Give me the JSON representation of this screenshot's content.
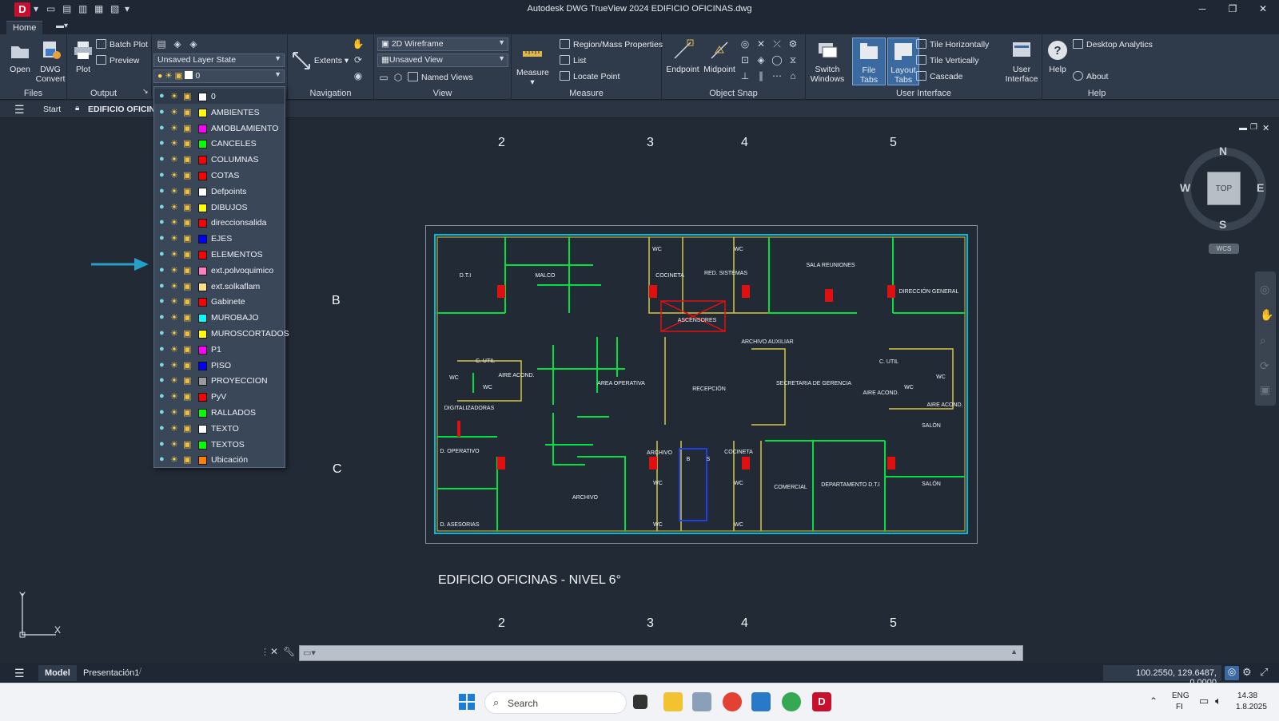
{
  "window": {
    "title": "Autodesk DWG TrueView 2024   EDIFICIO OFICINAS.dwg",
    "app_letter": "D"
  },
  "ribbon_tabs": [
    "Home"
  ],
  "ribbon": {
    "files": {
      "title": "Files",
      "open": "Open",
      "dwg_convert_1": "DWG",
      "dwg_convert_2": "Convert"
    },
    "output": {
      "title": "Output",
      "plot": "Plot",
      "batch_plot": "Batch Plot",
      "preview": "Preview"
    },
    "layers": {
      "layer_state": "Unsaved Layer State",
      "current_layer": "0"
    },
    "navigation": {
      "title": "Navigation",
      "extents": "Extents"
    },
    "view": {
      "title": "View",
      "visual_style": "2D Wireframe",
      "saved_view": "Unsaved View",
      "named_views": "Named Views"
    },
    "measure": {
      "title": "Measure",
      "measure": "Measure",
      "region_mass": "Region/Mass Properties",
      "list": "List",
      "locate_point": "Locate Point"
    },
    "osnap": {
      "title": "Object Snap",
      "endpoint": "Endpoint",
      "midpoint": "Midpoint"
    },
    "ui": {
      "title": "User Interface",
      "switch_1": "Switch",
      "switch_2": "Windows",
      "file_tabs": "File Tabs",
      "layout_1": "Layout",
      "layout_2": "Tabs",
      "tile_h": "Tile Horizontally",
      "tile_v": "Tile Vertically",
      "cascade": "Cascade",
      "user_1": "User",
      "user_2": "Interface"
    },
    "help": {
      "title": "Help",
      "help": "Help",
      "desktop_analytics": "Desktop Analytics",
      "about": "About"
    }
  },
  "file_tabs": {
    "start": "Start",
    "current": "EDIFICIO OFICINA"
  },
  "layers": [
    {
      "name": "0",
      "color": "#ffffff"
    },
    {
      "name": "AMBIENTES",
      "color": "#ffff00"
    },
    {
      "name": "AMOBLAMIENTO",
      "color": "#ff00ff"
    },
    {
      "name": "CANCELES",
      "color": "#00ff00"
    },
    {
      "name": "COLUMNAS",
      "color": "#ff0000"
    },
    {
      "name": "COTAS",
      "color": "#ff0000"
    },
    {
      "name": "Defpoints",
      "color": "#ffffff"
    },
    {
      "name": "DIBUJOS",
      "color": "#ffff00"
    },
    {
      "name": "direccionsalida",
      "color": "#ff0000"
    },
    {
      "name": "EJES",
      "color": "#0000ff"
    },
    {
      "name": "ELEMENTOS",
      "color": "#ff0000"
    },
    {
      "name": "ext.polvoquimico",
      "color": "#ff80c0"
    },
    {
      "name": "ext.solkaflam",
      "color": "#ffe08a"
    },
    {
      "name": "Gabinete",
      "color": "#ff0000"
    },
    {
      "name": "MUROBAJO",
      "color": "#00ffff"
    },
    {
      "name": "MUROSCORTADOS",
      "color": "#ffff00"
    },
    {
      "name": "P1",
      "color": "#ff00ff"
    },
    {
      "name": "PISO",
      "color": "#0000ff"
    },
    {
      "name": "PROYECCION",
      "color": "#9a9a9a"
    },
    {
      "name": "PyV",
      "color": "#ff0000"
    },
    {
      "name": "RALLADOS",
      "color": "#00ff00"
    },
    {
      "name": "TEXTO",
      "color": "#ffffff"
    },
    {
      "name": "TEXTOS",
      "color": "#00ff00"
    },
    {
      "name": "Ubicación",
      "color": "#ff8000"
    }
  ],
  "drawing": {
    "grid_top": [
      "2",
      "3",
      "4",
      "5"
    ],
    "grid_bottom": [
      "2",
      "3",
      "4",
      "5"
    ],
    "grid_left": [
      "B",
      "C"
    ],
    "plan_title": "EDIFICIO OFICINAS - NIVEL 6°",
    "rooms": [
      "D.T.I",
      "MALCO",
      "WC",
      "COCINETA",
      "RED. SISTEMAS",
      "WC",
      "SALA REUNIONES",
      "DIRECCIÓN GENERAL",
      "ASCENSORES",
      "ARCHIVO AUXILIAR",
      "C. UTIL",
      "AIRE ACOND.",
      "WC",
      "WC",
      "AREA OPERATIVA",
      "RECEPCIÓN",
      "SECRETARIA DE GERENCIA",
      "C. UTIL",
      "WC",
      "AIRE ACOND.",
      "WC",
      "AIRE ACOND.",
      "DIGITALIZADORAS",
      "SALÓN",
      "D. OPERATIVO",
      "ARCHIVO",
      "B",
      "S",
      "COCINETA",
      "WC",
      "WC",
      "ARCHIVO",
      "COMERCIAL",
      "DEPARTAMENTO D.T.I",
      "SALÓN",
      "D. ASESORIAS",
      "WC",
      "WC"
    ]
  },
  "viewcube": {
    "n": "N",
    "s": "S",
    "e": "E",
    "w": "W",
    "top": "TOP",
    "wcs": "WCS"
  },
  "axes": {
    "x": "X",
    "y": "Y"
  },
  "layout_tabs": {
    "model": "Model",
    "layout1": "Presentación1"
  },
  "coordinates": "100.2550, 129.6487, 0.0000",
  "taskbar": {
    "search": "Search",
    "lang1": "ENG",
    "lang2": "FI",
    "time": "14.38",
    "date": "1.8.2025"
  },
  "colors": {
    "ribbon": "#2f3a4a",
    "canvas": "#222a36",
    "accent": "#26a0c8"
  }
}
